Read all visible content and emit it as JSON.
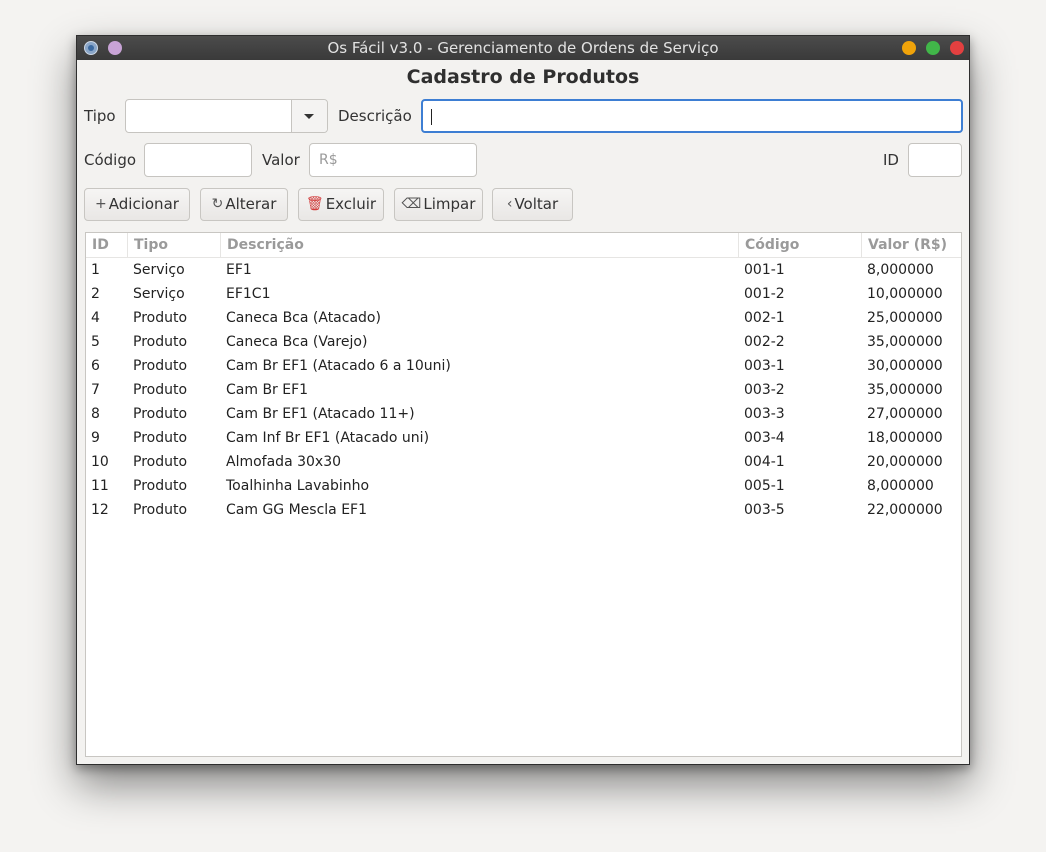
{
  "window": {
    "title": "Os Fácil v3.0 - Gerenciamento de Ordens de Serviço"
  },
  "form": {
    "heading": "Cadastro de Produtos",
    "tipo_label": "Tipo",
    "tipo_value": "",
    "descricao_label": "Descrição",
    "descricao_value": "",
    "codigo_label": "Código",
    "codigo_value": "",
    "valor_label": "Valor",
    "valor_placeholder": "R$",
    "id_label": "ID",
    "id_value": ""
  },
  "toolbar": {
    "adicionar_icon": "+",
    "adicionar_label": "Adicionar",
    "alterar_icon": "↻",
    "alterar_label": "Alterar",
    "excluir_icon": "🗑",
    "excluir_label": "Excluir",
    "limpar_icon": "⌫",
    "limpar_label": "Limpar",
    "voltar_icon": "‹",
    "voltar_label": "Voltar"
  },
  "table": {
    "columns": [
      "ID",
      "Tipo",
      "Descrição",
      "Código",
      "Valor (R$)"
    ],
    "rows": [
      [
        "1",
        "Serviço",
        "EF1",
        "001-1",
        "8,000000"
      ],
      [
        "2",
        "Serviço",
        "EF1C1",
        "001-2",
        "10,000000"
      ],
      [
        "4",
        "Produto",
        "Caneca Bca (Atacado)",
        "002-1",
        "25,000000"
      ],
      [
        "5",
        "Produto",
        "Caneca Bca (Varejo)",
        "002-2",
        "35,000000"
      ],
      [
        "6",
        "Produto",
        "Cam Br EF1 (Atacado 6 a 10uni)",
        "003-1",
        "30,000000"
      ],
      [
        "7",
        "Produto",
        "Cam Br EF1",
        "003-2",
        "35,000000"
      ],
      [
        "8",
        "Produto",
        "Cam Br EF1 (Atacado 11+)",
        "003-3",
        "27,000000"
      ],
      [
        "9",
        "Produto",
        "Cam Inf Br EF1 (Atacado uni)",
        "003-4",
        "18,000000"
      ],
      [
        "10",
        "Produto",
        "Almofada 30x30",
        "004-1",
        "20,000000"
      ],
      [
        "11",
        "Produto",
        "Toalhinha Lavabinho",
        "005-1",
        "8,000000"
      ],
      [
        "12",
        "Produto",
        "Cam GG Mescla EF1",
        "003-5",
        "22,000000"
      ]
    ]
  }
}
